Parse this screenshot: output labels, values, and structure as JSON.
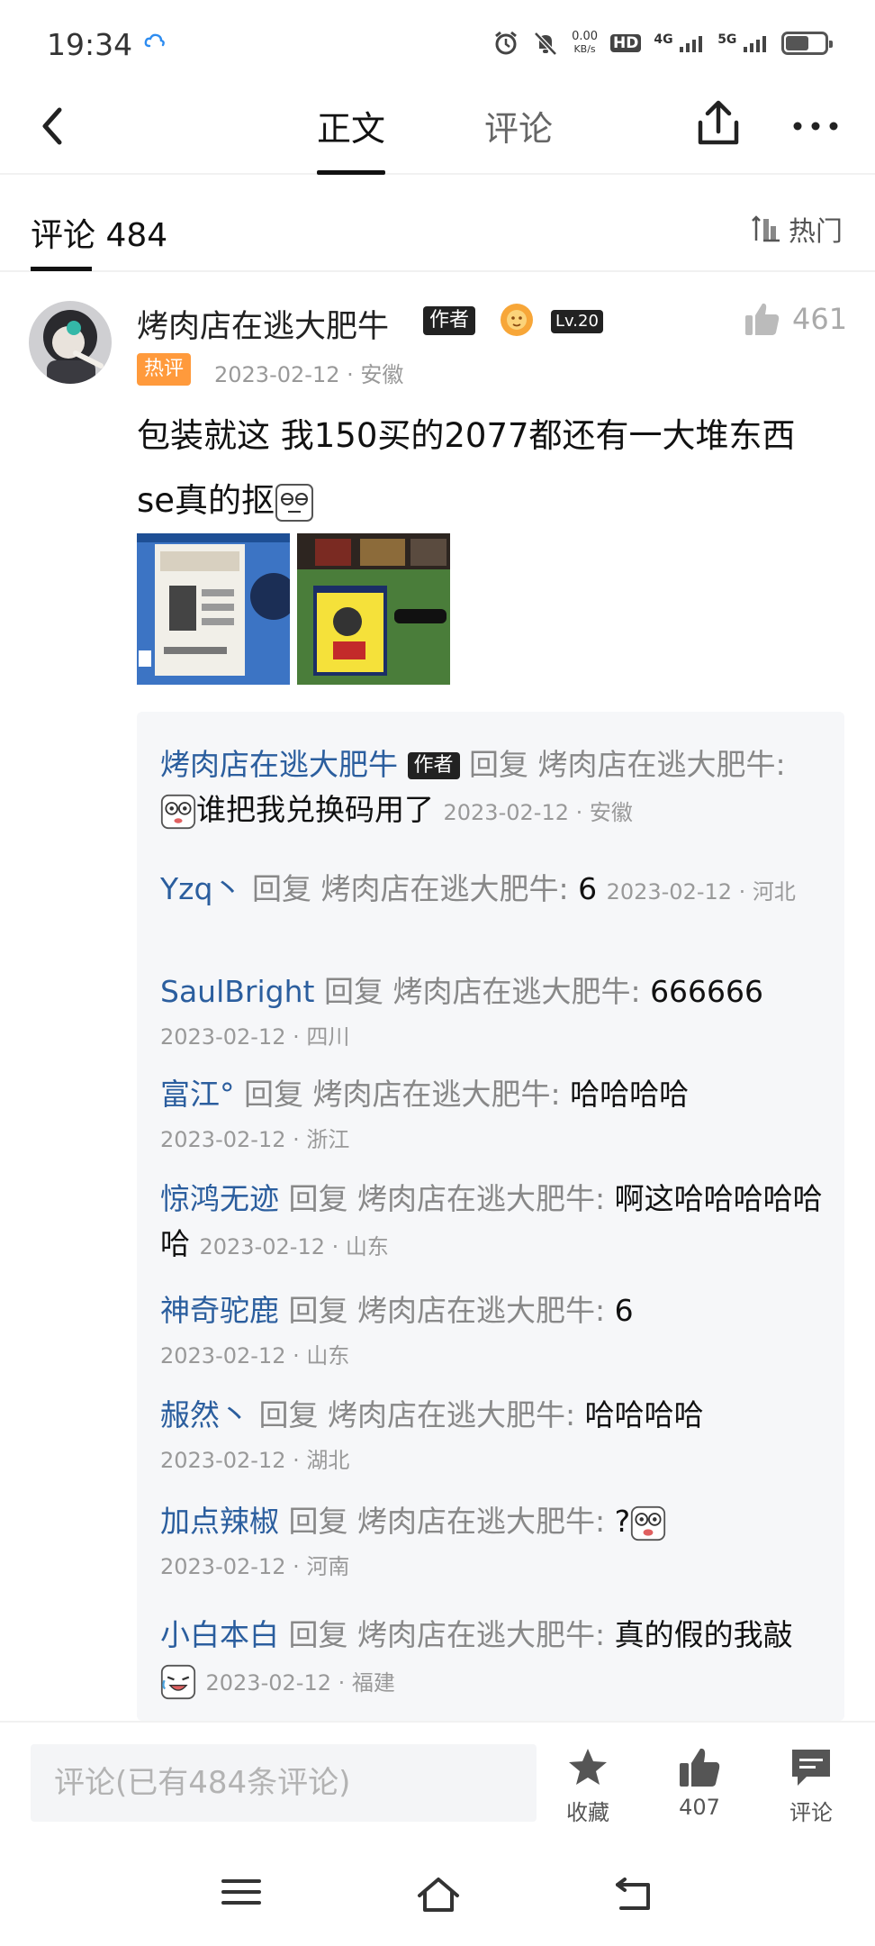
{
  "status_bar": {
    "time": "19:34",
    "speed_value": "0.00",
    "speed_unit": "KB/s",
    "hd_label": "HD",
    "net_4g": "4G",
    "net_5g": "5G",
    "battery_level": 0.55
  },
  "nav": {
    "tabs": [
      {
        "label": "正文",
        "active": true
      },
      {
        "label": "评论",
        "active": false
      }
    ]
  },
  "comments_header": {
    "title": "评论 484",
    "sort_label": "热门"
  },
  "comment": {
    "username": "烤肉店在逃大肥牛",
    "author_badge": "作者",
    "level_badge": "Lv.20",
    "likes": "461",
    "hot_badge": "热评",
    "meta": "2023-02-12 · 安徽",
    "body_line1": "包装就这 我150买的2077都还有一大堆东西",
    "body_line2": "se真的抠"
  },
  "replies": [
    {
      "user": "烤肉店在逃大肥牛",
      "badge": "作者",
      "word": "回复",
      "target": "烤肉店在逃大肥牛:",
      "text": "谁把我兑换码用了",
      "meta": "2023-02-12 · 安徽",
      "emoji": "wide-eyed-face-icon"
    },
    {
      "user": "Yzq丶",
      "word": "回复",
      "target": "烤肉店在逃大肥牛:",
      "text": "6",
      "meta": "2023-02-12 · 河北"
    },
    {
      "user": "SaulBright",
      "word": "回复",
      "target": "烤肉店在逃大肥牛:",
      "text": "666666",
      "meta": "2023-02-12 · 四川"
    },
    {
      "user": "富江°",
      "word": "回复",
      "target": "烤肉店在逃大肥牛:",
      "text": "哈哈哈哈",
      "meta": "2023-02-12 · 浙江"
    },
    {
      "user": "惊鸿无迹",
      "word": "回复",
      "target": "烤肉店在逃大肥牛:",
      "text": "啊这哈哈哈哈哈哈",
      "meta": "2023-02-12 · 山东"
    },
    {
      "user": "神奇驼鹿",
      "word": "回复",
      "target": "烤肉店在逃大肥牛:",
      "text": "6",
      "meta": "2023-02-12 · 山东"
    },
    {
      "user": "赧然丶",
      "word": "回复",
      "target": "烤肉店在逃大肥牛:",
      "text": "哈哈哈哈",
      "meta": "2023-02-12 · 湖北"
    },
    {
      "user": "加点辣椒",
      "word": "回复",
      "target": "烤肉店在逃大肥牛:",
      "text": "?",
      "meta": "2023-02-12 · 河南",
      "emoji": "shocked-face-icon"
    },
    {
      "user": "小白本白",
      "word": "回复",
      "target": "烤肉店在逃大肥牛:",
      "text": "真的假的我敲",
      "meta": "2023-02-12 · 福建",
      "emoji": "laughing-face-icon"
    }
  ],
  "bottom_bar": {
    "input_placeholder": "评论(已有484条评论)",
    "favorite_label": "收藏",
    "like_count": "407",
    "comment_label": "评论"
  },
  "colors": {
    "link_blue": "#2b5e9e",
    "hot_orange": "#ff9a3c",
    "reply_bg": "#f6f7f9"
  }
}
